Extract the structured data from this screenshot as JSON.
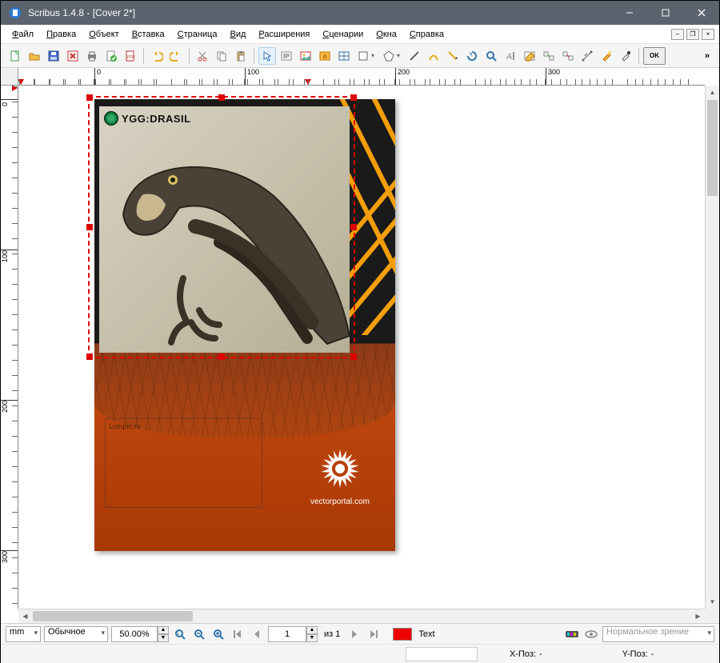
{
  "window": {
    "title": "Scribus 1.4.8 - [Cover 2*]"
  },
  "menu": {
    "items": [
      {
        "label": "Файл",
        "ukey": "Ф"
      },
      {
        "label": "Правка",
        "ukey": "П"
      },
      {
        "label": "Объект",
        "ukey": "О"
      },
      {
        "label": "Вставка",
        "ukey": "В"
      },
      {
        "label": "Страница",
        "ukey": "С"
      },
      {
        "label": "Вид",
        "ukey": "В"
      },
      {
        "label": "Расширения",
        "ukey": "Р"
      },
      {
        "label": "Сценарии",
        "ukey": "С"
      },
      {
        "label": "Окна",
        "ukey": "О"
      },
      {
        "label": "Справка",
        "ukey": "С"
      }
    ]
  },
  "ruler": {
    "h_ticks": [
      "0",
      "100",
      "200",
      "300"
    ],
    "v_ticks": [
      "0",
      "100",
      "200",
      "300"
    ]
  },
  "document": {
    "badge_text": "YGG:DRASIL",
    "textbox_content": "Lumpic.ru",
    "footer_text": "vectorportal.com"
  },
  "statusbar": {
    "unit": "mm",
    "layer": "Обычное",
    "zoom": "50.00%",
    "page_current": "1",
    "page_total_label": "из 1",
    "color_text": "Text",
    "view_mode": "Нормальное зрение",
    "xpos_label": "X-Поз:",
    "xpos_value": "-",
    "ypos_label": "Y-Поз:",
    "ypos_value": "-"
  },
  "icons": {
    "more": "»"
  }
}
